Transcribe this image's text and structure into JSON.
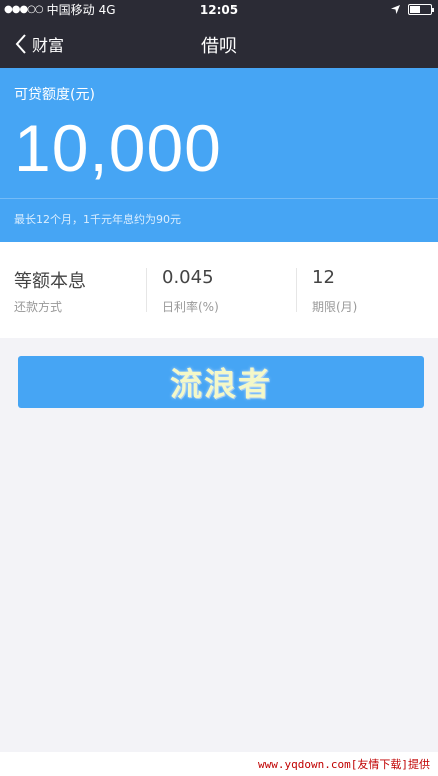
{
  "status_bar": {
    "signal": "●●●○○",
    "carrier": "中国移动",
    "network": "4G",
    "time": "12:05"
  },
  "nav": {
    "back_label": "财富",
    "title": "借呗"
  },
  "loan_card": {
    "label": "可贷额度(元)",
    "amount": "10,000",
    "note": "最长12个月，1千元年息约为90元"
  },
  "terms": [
    {
      "value": "等额本息",
      "label": "还款方式"
    },
    {
      "value": "0.045",
      "label": "日利率(%)"
    },
    {
      "value": "12",
      "label": "期限(月)"
    }
  ],
  "action_button": {
    "label": "流浪者"
  },
  "footer": {
    "watermark": "www.yqdown.com[友情下载]提供"
  },
  "colors": {
    "header_bg": "#2b2b35",
    "accent_blue": "#46a5f4",
    "page_bg": "#f3f3f7"
  }
}
